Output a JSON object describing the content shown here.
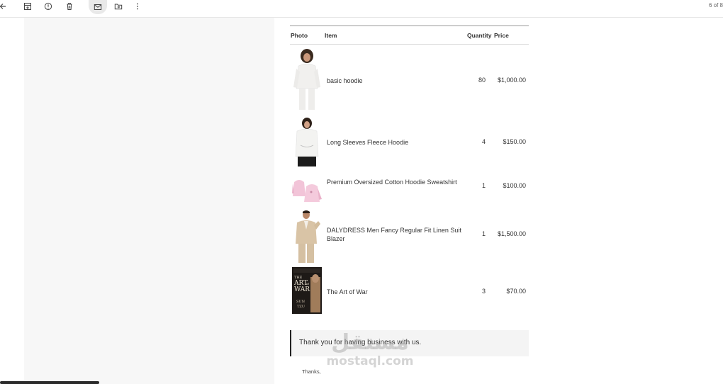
{
  "toolbar": {
    "items": [
      "back-icon",
      "archive-icon",
      "report-spam-icon",
      "delete-icon",
      "mark-unread-icon",
      "move-to-icon",
      "more-icon"
    ],
    "pager_text": "6 of 8"
  },
  "table": {
    "headers": {
      "photo": "Photo",
      "item": "Item",
      "quantity": "Quantity",
      "price": "Price"
    },
    "rows": [
      {
        "name": "basic hoodie",
        "quantity": "80",
        "price": "$1,000.00",
        "photo": "woman-white-hoodie-image"
      },
      {
        "name": "Long Sleeves Fleece Hoodie",
        "quantity": "4",
        "price": "$150.00",
        "photo": "woman-fleece-hoodie-image"
      },
      {
        "name": "Premium Oversized Cotton Hoodie Sweatshirt",
        "quantity": "1",
        "price": "$100.00",
        "photo": "pink-hoodies-image"
      },
      {
        "name": "DALYDRESS Men Fancy Regular Fit Linen Suit Blazer",
        "quantity": "1",
        "price": "$1,500.00",
        "photo": "man-linen-suit-image"
      },
      {
        "name": "The Art of War",
        "quantity": "3",
        "price": "$70.00",
        "photo": "art-of-war-book-cover"
      }
    ]
  },
  "book_cover": {
    "line1": "THE",
    "line2": "ART",
    "line3": "of",
    "line4": "WAR",
    "author1": "SUN",
    "author2": "TZU"
  },
  "thanks_message": "Thank you for having business with us.",
  "signoff": {
    "line1": "Thanks,",
    "line2": ""
  },
  "watermark": {
    "arabic": "مستقل",
    "latin": "mostaql.com"
  },
  "colors": {
    "page_bg": "#f7f7f7",
    "content_bg": "#ffffff",
    "quote_border": "#222222",
    "quote_bg": "#f4f4f4"
  }
}
